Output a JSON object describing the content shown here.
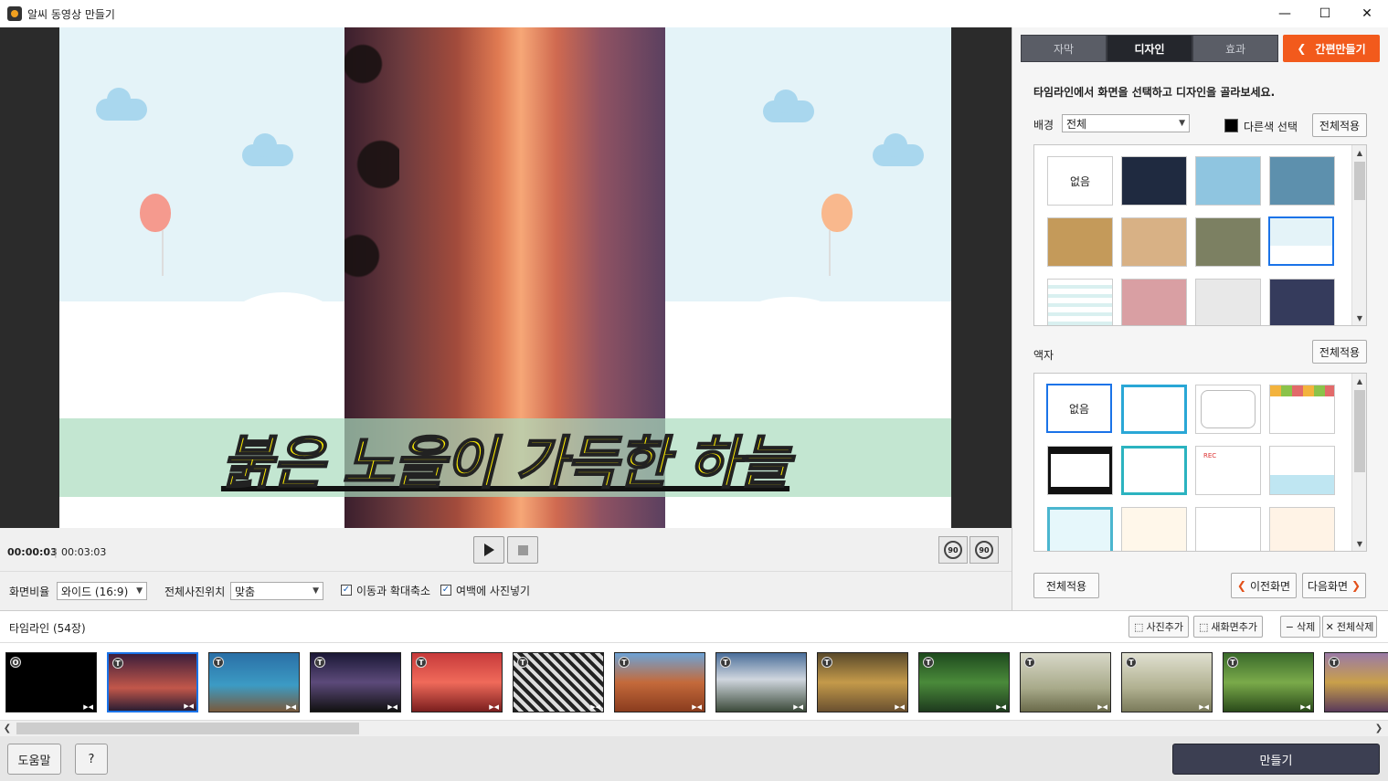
{
  "window": {
    "title": "알씨 동영상 만들기",
    "minimize": "—",
    "maximize": "☐",
    "close": "✕"
  },
  "preview": {
    "caption": "붉은 노을이 가득한 하늘"
  },
  "player": {
    "current_time": "00:00:03",
    "separator": "|",
    "total_time": "00:03:03",
    "rotate_left": "90",
    "rotate_right": "90"
  },
  "options": {
    "ratio_label": "화면비율",
    "ratio_value": "와이드 (16:9)",
    "position_label": "전체사진위치",
    "position_value": "맞춤",
    "pan_zoom_label": "이동과 확대축소",
    "pan_zoom_checked": true,
    "fill_margin_label": "여백에 사진넣기",
    "fill_margin_checked": true
  },
  "panel": {
    "tabs": [
      {
        "label": "자막",
        "active": false
      },
      {
        "label": "디자인",
        "active": true
      },
      {
        "label": "효과",
        "active": false
      }
    ],
    "simple_button": "간편만들기",
    "instruction": "타임라인에서 화면을 선택하고 디자인을 골라보세요.",
    "background_label": "배경",
    "background_select": "전체",
    "other_color_label": "다른색 선택",
    "other_color": "#000000",
    "apply_all": "전체적용",
    "background_thumbs": [
      "없음",
      "",
      "",
      "",
      "",
      "",
      "",
      "",
      "",
      "",
      "",
      ""
    ],
    "frame_label": "액자",
    "frame_thumbs": [
      "없음",
      "",
      "",
      "",
      "",
      "",
      "REC",
      "",
      "",
      "",
      "",
      ""
    ],
    "apply_all_bottom": "전체적용",
    "prev": "이전화면",
    "next": "다음화면"
  },
  "timeline": {
    "label": "타임라인 (54장)",
    "add_photo": "사진추가",
    "add_screen": "새화면추가",
    "delete": "삭제",
    "delete_all": "전체삭제",
    "frames": [
      {
        "badge": "O"
      },
      {
        "badge": "T"
      },
      {
        "badge": "T"
      },
      {
        "badge": "T"
      },
      {
        "badge": "T"
      },
      {
        "badge": "T"
      },
      {
        "badge": "T"
      },
      {
        "badge": "T"
      },
      {
        "badge": "T"
      },
      {
        "badge": "T"
      },
      {
        "badge": "T"
      },
      {
        "badge": "T"
      },
      {
        "badge": "T"
      },
      {
        "badge": "T"
      }
    ]
  },
  "footer": {
    "help": "도움말",
    "question": "?",
    "make": "만들기"
  }
}
